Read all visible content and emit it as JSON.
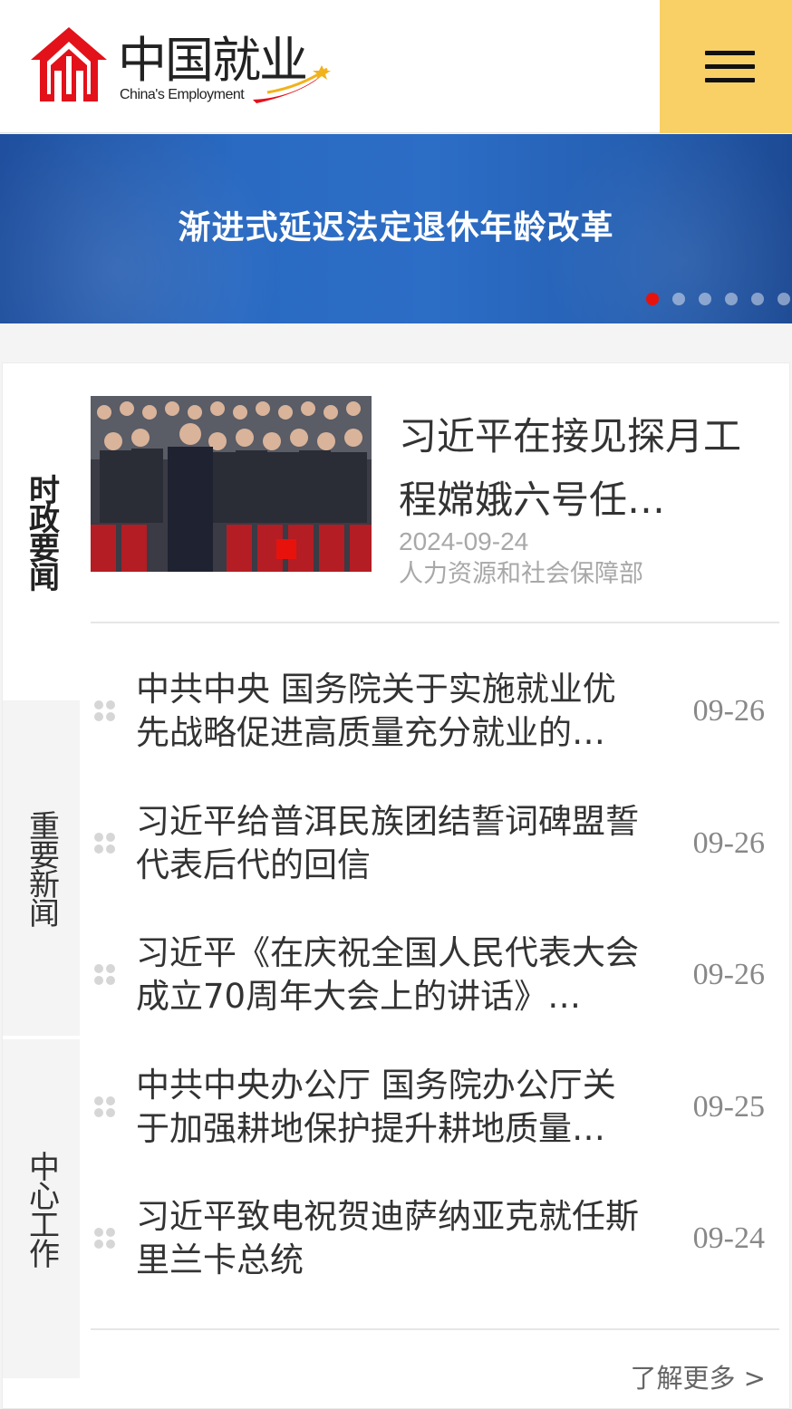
{
  "header": {
    "logo_cn": "中国就业",
    "logo_en": "China's Employment",
    "menu_icon": "hamburger-menu-icon",
    "colors": {
      "logo_red": "#e3111a",
      "menu_bg": "#f8d065"
    }
  },
  "banner": {
    "title": "渐进式延迟法定退休年龄改革",
    "slide_count": 6,
    "active_slide": 1,
    "colors": {
      "active_dot": "#e8120c",
      "bg": "#2a6ac2"
    }
  },
  "tabs": [
    {
      "label": "时政要闻",
      "active": true
    },
    {
      "label": "重要新闻",
      "active": false
    },
    {
      "label": "中心工作",
      "active": false
    }
  ],
  "featured": {
    "title": "习近平在接见探月工程嫦娥六号任…",
    "date": "2024-09-24",
    "source": "人力资源和社会保障部"
  },
  "news": [
    {
      "title": "中共中央 国务院关于实施就业优先战略促进高质量充分就业的…",
      "date": "09-26"
    },
    {
      "title": "习近平给普洱民族团结誓词碑盟誓代表后代的回信",
      "date": "09-26"
    },
    {
      "title": "习近平《在庆祝全国人民代表大会成立70周年大会上的讲话》…",
      "date": "09-26"
    },
    {
      "title": "中共中央办公厅 国务院办公厅关于加强耕地保护提升耕地质量…",
      "date": "09-25"
    },
    {
      "title": "习近平致电祝贺迪萨纳亚克就任斯里兰卡总统",
      "date": "09-24"
    }
  ],
  "more_label": "了解更多 >"
}
